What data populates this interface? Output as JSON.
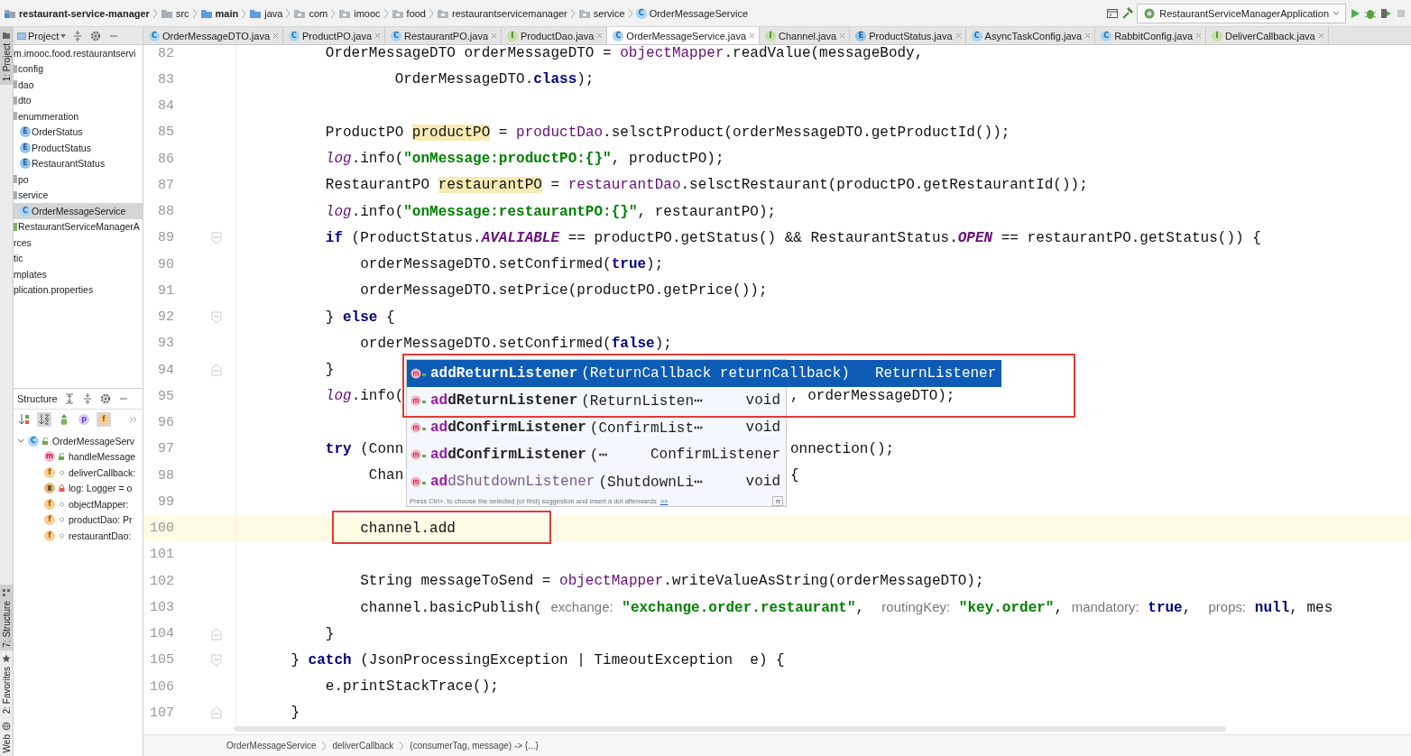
{
  "navbar": {
    "path": [
      {
        "label": "restaurant-service-manager",
        "kind": "project",
        "bold": true
      },
      {
        "label": "src",
        "kind": "folder",
        "bold": false
      },
      {
        "label": "main",
        "kind": "source",
        "bold": true
      },
      {
        "label": "java",
        "kind": "source",
        "bold": false
      },
      {
        "label": "com",
        "kind": "package",
        "bold": false
      },
      {
        "label": "imooc",
        "kind": "package",
        "bold": false
      },
      {
        "label": "food",
        "kind": "package",
        "bold": false
      },
      {
        "label": "restaurantservicemanager",
        "kind": "package",
        "bold": false
      },
      {
        "label": "service",
        "kind": "package",
        "bold": false
      },
      {
        "label": "OrderMessageService",
        "kind": "class",
        "badge": "C",
        "bold": false
      }
    ],
    "run_config": "RestaurantServiceManagerApplication"
  },
  "tool_windows": [
    {
      "label": "1: Project",
      "kind": "project",
      "selected": true
    },
    {
      "label": "7: Structure",
      "kind": "structure",
      "selected": true
    },
    {
      "label": "2: Favorites",
      "kind": "favorites",
      "selected": false
    },
    {
      "label": "Web",
      "kind": "web",
      "selected": false
    }
  ],
  "project": {
    "title": "Project",
    "tree": [
      {
        "label": "m.imooc.food.restaurantservi",
        "selected": false,
        "children": [
          {
            "label": "config",
            "kind": "folder",
            "selected": false
          },
          {
            "label": "dao",
            "kind": "folder",
            "selected": false
          },
          {
            "label": "dto",
            "kind": "folder",
            "selected": false
          },
          {
            "label": "enummeration",
            "kind": "folder",
            "selected": false,
            "children": [
              {
                "label": "OrderStatus",
                "kind": "enum",
                "badge": "E",
                "selected": false
              },
              {
                "label": "ProductStatus",
                "kind": "enum",
                "badge": "E",
                "selected": false
              },
              {
                "label": "RestaurantStatus",
                "kind": "enum",
                "badge": "E",
                "selected": false
              }
            ]
          },
          {
            "label": "po",
            "kind": "folder",
            "selected": false
          },
          {
            "label": "service",
            "kind": "folder",
            "selected": false,
            "children": [
              {
                "label": "OrderMessageService",
                "kind": "class",
                "badge": "C",
                "selected": true
              }
            ]
          },
          {
            "label": "RestaurantServiceManagerA",
            "kind": "app",
            "selected": false
          }
        ]
      },
      {
        "label": "rces",
        "selected": false
      },
      {
        "label": "tic",
        "selected": false
      },
      {
        "label": "mplates",
        "selected": false
      },
      {
        "label": "plication.properties",
        "selected": false
      }
    ]
  },
  "structure": {
    "title": "Structure",
    "filters": [
      {
        "kind": "sort-visibility",
        "selected": false
      },
      {
        "kind": "sort-alpha",
        "selected": true
      },
      {
        "kind": "inherited",
        "selected": false
      },
      {
        "kind": "property",
        "badge": "p",
        "selected": false
      },
      {
        "kind": "field",
        "badge": "f",
        "selected": true
      }
    ],
    "tree": [
      {
        "label": "OrderMessageServ",
        "kind": "class",
        "badge": "C",
        "access": {
          "kind": "public"
        },
        "expanded": true,
        "children": [
          {
            "label": "handleMessage",
            "kind": "method",
            "badge": "m",
            "access": {
              "kind": "public"
            }
          },
          {
            "label": "deliverCallback:",
            "kind": "field",
            "badge": "f",
            "access": {
              "kind": "package"
            }
          },
          {
            "label": "log: Logger = o",
            "kind": "logger",
            "access": {
              "kind": "private"
            }
          },
          {
            "label": "objectMapper:",
            "kind": "field",
            "badge": "f",
            "access": {
              "kind": "package"
            }
          },
          {
            "label": "productDao: Pr",
            "kind": "field",
            "badge": "f",
            "access": {
              "kind": "package"
            }
          },
          {
            "label": "restaurantDao:",
            "kind": "field",
            "badge": "f",
            "access": {
              "kind": "package"
            }
          }
        ]
      }
    ]
  },
  "tabs": [
    {
      "label": "OrderMessageDTO.java",
      "kind": "class",
      "badge": "C",
      "selected": false
    },
    {
      "label": "ProductPO.java",
      "kind": "class",
      "badge": "C",
      "selected": false
    },
    {
      "label": "RestaurantPO.java",
      "kind": "class",
      "badge": "C",
      "selected": false
    },
    {
      "label": "ProductDao.java",
      "kind": "interface",
      "badge": "I",
      "selected": false
    },
    {
      "label": "OrderMessageService.java",
      "kind": "class",
      "badge": "C",
      "selected": true
    },
    {
      "label": "Channel.java",
      "kind": "interface",
      "badge": "I",
      "selected": false
    },
    {
      "label": "ProductStatus.java",
      "kind": "enum",
      "badge": "E",
      "selected": false
    },
    {
      "label": "AsyncTaskConfig.java",
      "kind": "class",
      "badge": "C",
      "selected": false
    },
    {
      "label": "RabbitConfig.java",
      "kind": "class",
      "badge": "C",
      "selected": false
    },
    {
      "label": "DeliverCallback.java",
      "kind": "interface",
      "badge": "I",
      "selected": false
    }
  ],
  "editor": {
    "lines": [
      {
        "number": "82",
        "current": false,
        "tokens": [
          {
            "kind": "plain",
            "text": "        OrderMessageDTO orderMessageDTO = "
          },
          {
            "kind": "field",
            "text": "objectMapper"
          },
          {
            "kind": "plain",
            "text": ".readValue(messageBody,"
          }
        ]
      },
      {
        "number": "83",
        "current": false,
        "tokens": [
          {
            "kind": "plain",
            "text": "                OrderMessageDTO."
          },
          {
            "kind": "kw",
            "text": "class"
          },
          {
            "kind": "plain",
            "text": ");"
          }
        ]
      },
      {
        "number": "84",
        "current": false
      },
      {
        "number": "85",
        "current": false,
        "tokens": [
          {
            "kind": "plain",
            "text": "        ProductPO "
          },
          {
            "kind": "hl",
            "text": "productPO"
          },
          {
            "kind": "plain",
            "text": " = "
          },
          {
            "kind": "field",
            "text": "productDao"
          },
          {
            "kind": "plain",
            "text": ".selsctProduct(orderMessageDTO.getProductId());"
          }
        ]
      },
      {
        "number": "86",
        "current": false,
        "tokens": [
          {
            "kind": "log",
            "text": "        log"
          },
          {
            "kind": "plain",
            "text": ".info("
          },
          {
            "kind": "str",
            "text": "\"onMessage:productPO:{}\""
          },
          {
            "kind": "plain",
            "text": ", productPO);"
          }
        ]
      },
      {
        "number": "87",
        "current": false,
        "tokens": [
          {
            "kind": "plain",
            "text": "        RestaurantPO "
          },
          {
            "kind": "hl",
            "text": "restaurantPO"
          },
          {
            "kind": "plain",
            "text": " = "
          },
          {
            "kind": "field",
            "text": "restaurantDao"
          },
          {
            "kind": "plain",
            "text": ".selsctRestaurant(productPO.getRestaurantId());"
          }
        ]
      },
      {
        "number": "88",
        "current": false,
        "tokens": [
          {
            "kind": "log",
            "text": "        log"
          },
          {
            "kind": "plain",
            "text": ".info("
          },
          {
            "kind": "str",
            "text": "\"onMessage:restaurantPO:{}\""
          },
          {
            "kind": "plain",
            "text": ", restaurantPO);"
          }
        ]
      },
      {
        "number": "89",
        "current": false,
        "fold": {
          "kind": "start"
        },
        "tokens": [
          {
            "kind": "kw",
            "text": "        if"
          },
          {
            "kind": "plain",
            "text": " (ProductStatus."
          },
          {
            "kind": "const",
            "text": "AVALIABLE"
          },
          {
            "kind": "plain",
            "text": " == productPO.getStatus() && RestaurantStatus."
          },
          {
            "kind": "const",
            "text": "OPEN"
          },
          {
            "kind": "plain",
            "text": " == restaurantPO.getStatus()) {"
          }
        ]
      },
      {
        "number": "90",
        "current": false,
        "tokens": [
          {
            "kind": "plain",
            "text": "            orderMessageDTO.setConfirmed("
          },
          {
            "kind": "kw",
            "text": "true"
          },
          {
            "kind": "plain",
            "text": ");"
          }
        ]
      },
      {
        "number": "91",
        "current": false,
        "tokens": [
          {
            "kind": "plain",
            "text": "            orderMessageDTO.setPrice(productPO.getPrice());"
          }
        ]
      },
      {
        "number": "92",
        "current": false,
        "fold": {
          "kind": "start"
        },
        "tokens": [
          {
            "kind": "plain",
            "text": "        } "
          },
          {
            "kind": "kw",
            "text": "else"
          },
          {
            "kind": "plain",
            "text": " {"
          }
        ]
      },
      {
        "number": "93",
        "current": false,
        "tokens": [
          {
            "kind": "plain",
            "text": "            orderMessageDTO.setConfirmed("
          },
          {
            "kind": "kw",
            "text": "false"
          },
          {
            "kind": "plain",
            "text": ");"
          }
        ]
      },
      {
        "number": "94",
        "current": false,
        "fold": {
          "kind": "end"
        },
        "tokens": [
          {
            "kind": "plain",
            "text": "        }"
          }
        ]
      },
      {
        "number": "95",
        "current": false,
        "tokens": [
          {
            "kind": "log",
            "text": "        log"
          },
          {
            "kind": "plain",
            "text": ".info("
          }
        ],
        "after_popup": [
          {
            "kind": "plain",
            "text": ", orderMessageDTO);"
          }
        ]
      },
      {
        "number": "96",
        "current": false
      },
      {
        "number": "97",
        "current": false,
        "tokens": [
          {
            "kind": "kw",
            "text": "        try"
          },
          {
            "kind": "plain",
            "text": " (Conn"
          }
        ],
        "after_popup": [
          {
            "kind": "plain",
            "text": "onnection();"
          }
        ]
      },
      {
        "number": "98",
        "current": false,
        "tokens": [
          {
            "kind": "plain",
            "text": "             Chan"
          }
        ],
        "after_popup": [
          {
            "kind": "plain",
            "text": "{"
          }
        ]
      },
      {
        "number": "99",
        "current": false
      },
      {
        "number": "100",
        "current": true,
        "tokens": [
          {
            "kind": "plain",
            "text": "            channel.add"
          }
        ]
      },
      {
        "number": "101",
        "current": false
      },
      {
        "number": "102",
        "current": false,
        "tokens": [
          {
            "kind": "plain",
            "text": "            String messageToSend = "
          },
          {
            "kind": "field",
            "text": "objectMapper"
          },
          {
            "kind": "plain",
            "text": ".writeValueAsString(orderMessageDTO);"
          }
        ]
      },
      {
        "number": "103",
        "current": false,
        "tokens": [
          {
            "kind": "plain",
            "text": "            channel.basicPublish( "
          },
          {
            "kind": "hint",
            "text": "exchange:"
          },
          {
            "kind": "str",
            "text": " \"exchange.order.restaurant\""
          },
          {
            "kind": "plain",
            "text": ",  "
          },
          {
            "kind": "hint",
            "text": "routingKey:"
          },
          {
            "kind": "str",
            "text": " \"key.order\""
          },
          {
            "kind": "plain",
            "text": ", "
          },
          {
            "kind": "hint",
            "text": "mandatory:"
          },
          {
            "kind": "kw",
            "text": " true"
          },
          {
            "kind": "plain",
            "text": ",  "
          },
          {
            "kind": "hint",
            "text": "props:"
          },
          {
            "kind": "kw",
            "text": " null"
          },
          {
            "kind": "plain",
            "text": ", mes"
          }
        ]
      },
      {
        "number": "104",
        "current": false,
        "fold": {
          "kind": "end"
        },
        "tokens": [
          {
            "kind": "plain",
            "text": "        }"
          }
        ]
      },
      {
        "number": "105",
        "current": false,
        "fold": {
          "kind": "start"
        },
        "tokens": [
          {
            "kind": "plain",
            "text": "    } "
          },
          {
            "kind": "kw",
            "text": "catch"
          },
          {
            "kind": "plain",
            "text": " (JsonProcessingException | TimeoutException  e) {"
          }
        ]
      },
      {
        "number": "106",
        "current": false,
        "tokens": [
          {
            "kind": "plain",
            "text": "        e.printStackTrace();"
          }
        ]
      },
      {
        "number": "107",
        "current": false,
        "fold": {
          "kind": "end"
        },
        "tokens": [
          {
            "kind": "plain",
            "text": "    }"
          }
        ]
      }
    ],
    "completion": {
      "items": [
        {
          "match": "ad",
          "name": "dReturnListener",
          "params": "(ReturnCallback returnCallback)",
          "type": "ReturnListener",
          "bold": true,
          "selected": true
        },
        {
          "match": "ad",
          "name": "dReturnListener",
          "params": "(ReturnListen⋯",
          "type": "void",
          "bold": true,
          "selected": false
        },
        {
          "match": "ad",
          "name": "dConfirmListener",
          "params": "(ConfirmList⋯",
          "type": "void",
          "bold": true,
          "selected": false
        },
        {
          "match": "ad",
          "name": "dConfirmListener",
          "params": "(⋯",
          "type": "ConfirmListener",
          "bold": true,
          "selected": false
        },
        {
          "match": "ad",
          "name": "dShutdownListener",
          "params": "(ShutdownLi⋯",
          "type": "void",
          "bold": false,
          "selected": false
        }
      ],
      "hint": "Press Ctrl+. to choose the selected (or first) suggestion and insert a dot afterwards",
      "hint_link": ">>",
      "pi": "π"
    },
    "breadcrumb": [
      "OrderMessageService",
      "deliverCallback",
      "(consumerTag, message) -> {...}"
    ]
  }
}
